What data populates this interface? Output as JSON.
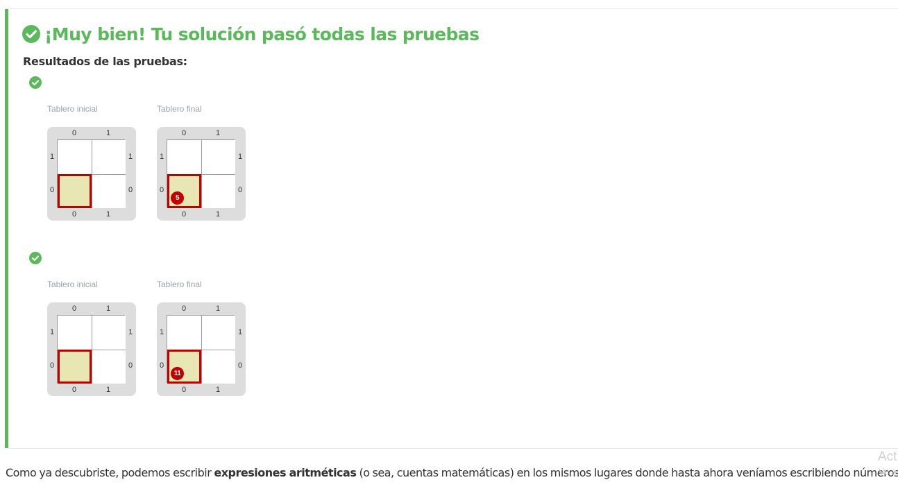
{
  "result": {
    "headline": "¡Muy bien! Tu solución pasó todas las pruebas",
    "subheading": "Resultados de las pruebas:",
    "tests": [
      {
        "status": "passed",
        "initial_caption": "Tablero inicial",
        "final_caption": "Tablero final",
        "columns": [
          "0",
          "1"
        ],
        "rows": [
          "1",
          "0"
        ],
        "head_cell": {
          "column": 0,
          "row": 0
        },
        "final_ball_count": "5"
      },
      {
        "status": "passed",
        "initial_caption": "Tablero inicial",
        "final_caption": "Tablero final",
        "columns": [
          "0",
          "1"
        ],
        "rows": [
          "1",
          "0"
        ],
        "head_cell": {
          "column": 0,
          "row": 0
        },
        "final_ball_count": "11"
      }
    ]
  },
  "paragraph": {
    "before": "Como ya descubriste, podemos escribir ",
    "bold": "expresiones aritméticas",
    "after": " (o sea, cuentas matemáticas) en los mismos lugares donde hasta ahora veníamos escribiendo números."
  },
  "watermark": {
    "line1": "Act",
    "line2": "Ve a"
  },
  "colors": {
    "success": "#5cb85c",
    "head_border": "#c00000",
    "head_fill": "#e8e6b2",
    "ball": "#c00000",
    "board_bg": "#dddddd"
  },
  "icons": {
    "success": "check-circle-icon"
  }
}
